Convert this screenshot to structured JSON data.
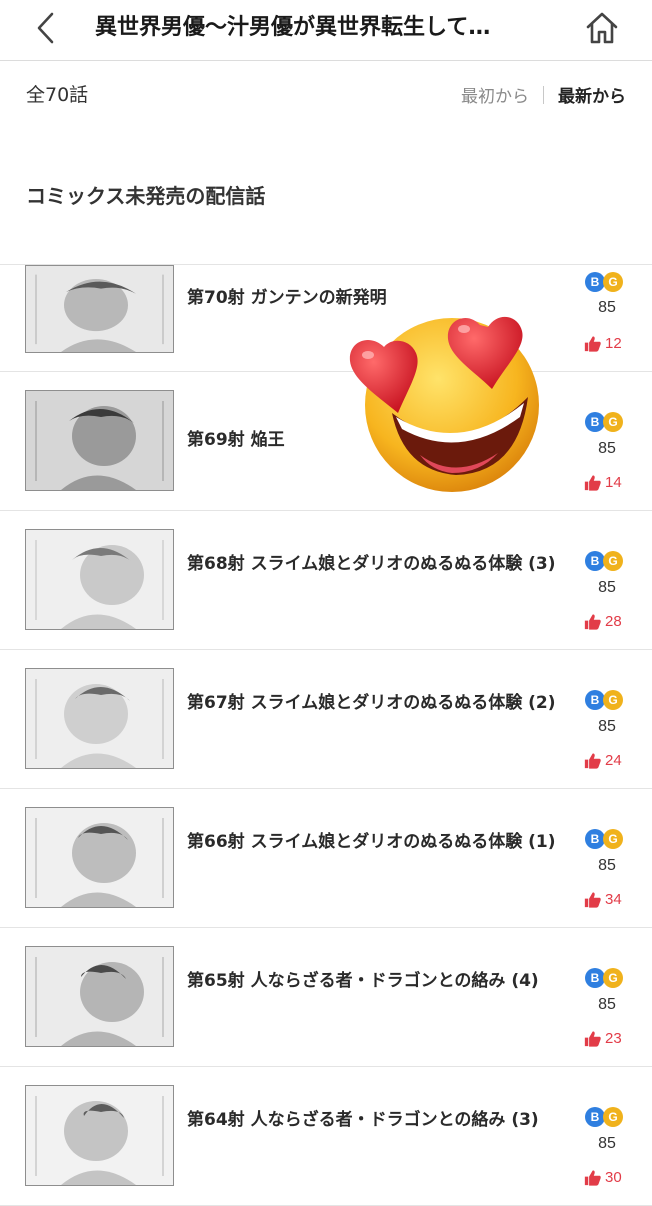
{
  "header": {
    "title": "異世界男優〜汁男優が異世界転生して…",
    "back_icon": "chevron-left-icon",
    "home_icon": "home-icon"
  },
  "summary": {
    "total": "全70話",
    "sort_first": "最初から",
    "sort_latest": "最新から"
  },
  "section": {
    "title": "コミックス未発売の配信話"
  },
  "badges": {
    "b": "B",
    "g": "G"
  },
  "colors": {
    "badge_b": "#2f7fe0",
    "badge_g": "#f0b21c",
    "like": "#e23c48"
  },
  "episodes": [
    {
      "title": "第70射 ガンテンの新発明",
      "price": "85",
      "likes": "12"
    },
    {
      "title": "第69射 焔王",
      "price": "85",
      "likes": "14"
    },
    {
      "title": "第68射 スライム娘とダリオのぬるぬる体験 (3)",
      "price": "85",
      "likes": "28"
    },
    {
      "title": "第67射 スライム娘とダリオのぬるぬる体験 (2)",
      "price": "85",
      "likes": "24"
    },
    {
      "title": "第66射 スライム娘とダリオのぬるぬる体験 (1)",
      "price": "85",
      "likes": "34"
    },
    {
      "title": "第65射 人ならざる者・ドラゴンとの絡み (4)",
      "price": "85",
      "likes": "23"
    },
    {
      "title": "第64射 人ならざる者・ドラゴンとの絡み (3)",
      "price": "85",
      "likes": "30"
    }
  ],
  "overlay_emoji": "heart-eyes-grinning-emoji"
}
